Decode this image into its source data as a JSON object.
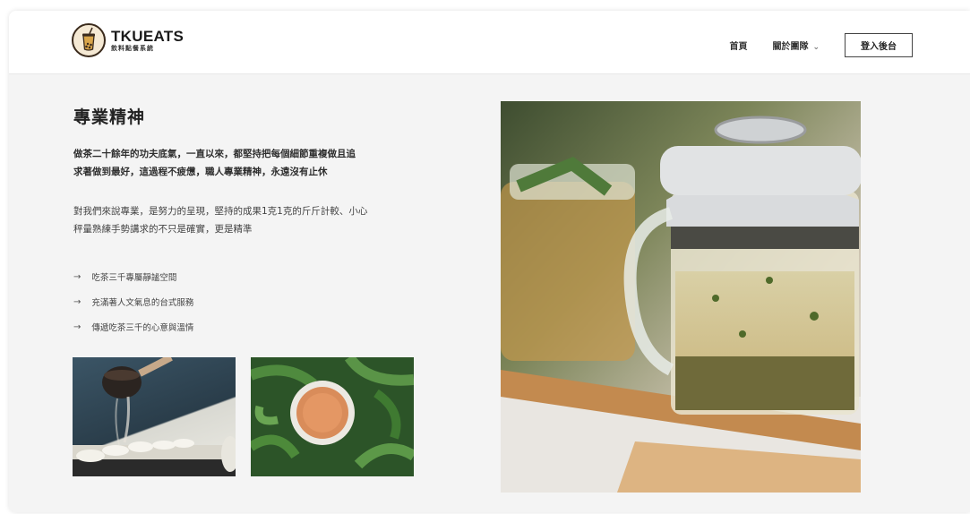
{
  "header": {
    "logo_title": "TKUEATS",
    "logo_sub": "飲料點餐系統",
    "nav": {
      "home": "首頁",
      "about": "關於團隊",
      "about_caret": "⌄",
      "login": "登入後台"
    }
  },
  "section": {
    "title": "專業精神",
    "para1_line1": "做茶二十餘年的功夫底氣，一直以來，都堅持把每個細節重複做且追",
    "para1_line2": "求著做到最好，這過程不疲憊，職人專業精神，永遠沒有止休",
    "para2_line1": "對我們來說專業，是努力的呈現，堅持的成果1克1克的斤斤計較、小心",
    "para2_line2": "秤量熟練手勢講求的不只是確實，更是精準",
    "list": [
      {
        "arrow": "→",
        "text": "吃茶三千專屬靜謐空間"
      },
      {
        "arrow": "→",
        "text": "充滿著人文氣息的台式服務"
      },
      {
        "arrow": "→",
        "text": "傳遞吃茶三千的心意與溫情"
      }
    ]
  },
  "colors": {
    "page_bg": "#f4f4f4",
    "header_bg": "#ffffff",
    "text": "#2a2a2a"
  }
}
